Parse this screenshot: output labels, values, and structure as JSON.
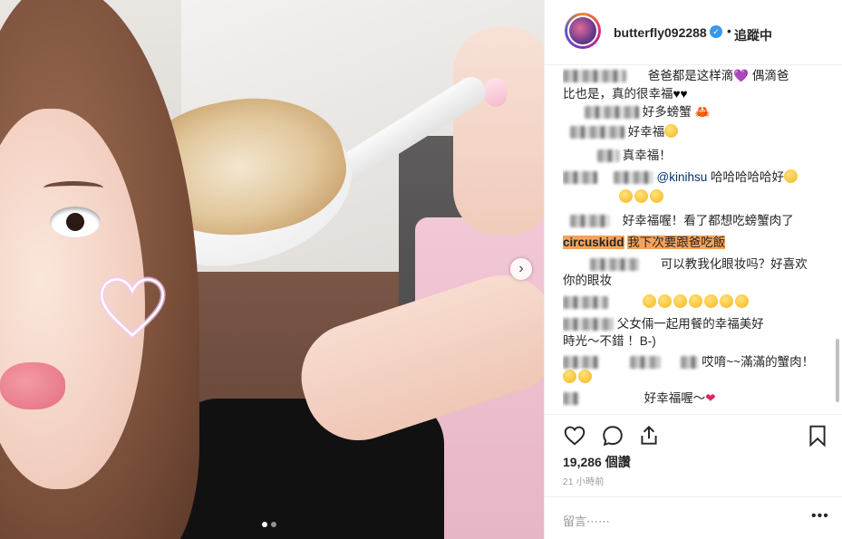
{
  "post": {
    "username": "butterfly092288",
    "separator": "•",
    "follow_label": "追蹤中",
    "carousel": {
      "page_count": 2,
      "active_index": 1
    },
    "likes": "19,286 個讚",
    "time": "21 小時前",
    "comment_placeholder": "留言⋯⋯"
  },
  "comments": [
    {
      "text": "爸爸都是这样滴",
      "emoji_after": "purple-heart",
      "text2": "偶滴爸"
    },
    {
      "text": "比也是，真的很幸福",
      "emoji_after": "black-hearts"
    },
    {
      "text": "好多螃蟹",
      "emoji_after": "crab"
    },
    {
      "text": "好幸福",
      "emoji_after": "smile"
    },
    {
      "text": "真幸福！"
    },
    {
      "mention": "@kinihsu",
      "text": "哈哈哈哈哈好"
    },
    {
      "text": "",
      "emoji_after": "smiles-3"
    },
    {
      "text": "好幸福喔！看了都想吃螃蟹肉了"
    },
    {
      "user": "circuskidd",
      "text": "我下次要跟爸吃飯"
    },
    {
      "text": "可以教我化眼妆吗？好喜欢"
    },
    {
      "text": "你的眼妆"
    },
    {
      "text": "",
      "emoji_after": "smiles-7"
    },
    {
      "text": "父女倆一起用餐的幸福美好"
    },
    {
      "text": "時光～不錯 ！B-)"
    },
    {
      "text": "哎唷~~滿滿的蟹肉！"
    },
    {
      "text": "",
      "emoji_after": "laugh-2"
    },
    {
      "text": "好幸福喔～",
      "emoji_after": "red-heart"
    }
  ],
  "icons": {
    "like": "heart-outline-icon",
    "comment": "comment-bubble-icon",
    "share": "share-arrow-icon",
    "save": "bookmark-icon",
    "more": "more-dots-icon",
    "next": "chevron-right-icon",
    "verified": "verified-badge-icon"
  },
  "colors": {
    "verified": "#3897f0",
    "highlight": "#f5a35a",
    "mention": "#003569"
  }
}
